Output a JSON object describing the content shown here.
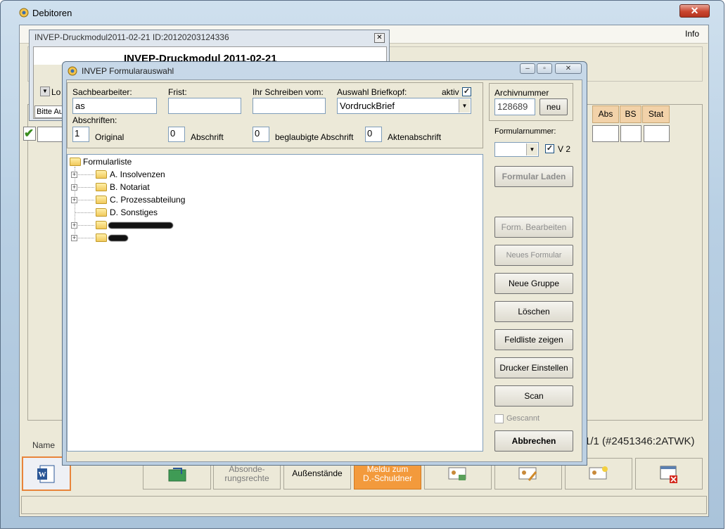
{
  "main_window": {
    "title": "Debitoren",
    "close_glyph": "✕",
    "menu": {
      "info": "Info"
    },
    "grid_headers": [
      "Abs",
      "BS",
      "Stat"
    ],
    "name_label": "Name",
    "record_info": "1/1 (#2451346:2ATWK)",
    "toolbar": {
      "absonderungsrechte": "Absonde-\nrungsrechte",
      "aussenstaende": "Außenstände",
      "meldung": "Meldu zum\nD.-Schuldner"
    }
  },
  "druck_window": {
    "title": "INVEP-Druckmodul2011-02-21 ID:20120203124336",
    "heading": "INVEP-Druckmodul 2011-02-21",
    "lo_label": "Lo",
    "bitte_label": "Bitte Au"
  },
  "dialog": {
    "title": "INVEP Formularauswahl",
    "labels": {
      "sachbearbeiter": "Sachbearbeiter:",
      "frist": "Frist:",
      "ihr_schreiben": "Ihr Schreiben vom:",
      "briefkopf": "Auswahl Briefkopf:",
      "aktiv": "aktiv",
      "abschriften": "Abschriften:",
      "original": "Original",
      "abschrift": "Abschrift",
      "beglaubigte": "beglaubigte Abschrift",
      "akten": "Aktenabschrift"
    },
    "values": {
      "sachbearbeiter": "as",
      "frist": "",
      "ihr_schreiben": "",
      "briefkopf": "VordruckBrief",
      "aktiv": true,
      "original_count": "1",
      "abschrift_count": "0",
      "beglaubigte_count": "0",
      "akten_count": "0"
    },
    "tree": {
      "root": "Formularliste",
      "items": [
        {
          "label": "A. Insolvenzen",
          "expandable": true
        },
        {
          "label": "B. Notariat",
          "expandable": true
        },
        {
          "label": "C. Prozessabteilung",
          "expandable": true
        },
        {
          "label": "D. Sonstiges",
          "expandable": false
        }
      ]
    },
    "archiv": {
      "label": "Archivnummer",
      "value": "128689",
      "neu_button": "neu"
    },
    "formularnummer": {
      "label": "Formularnummer:",
      "value": "",
      "v2_label": "V 2",
      "v2_checked": true
    },
    "buttons": {
      "laden": "Formular Laden",
      "bearbeiten": "Form. Bearbeiten",
      "neues": "Neues Formular",
      "gruppe": "Neue Gruppe",
      "loeschen": "Löschen",
      "feldliste": "Feldliste zeigen",
      "drucker": "Drucker Einstellen",
      "scan": "Scan",
      "abbrechen": "Abbrechen"
    },
    "gescannt": {
      "label": "Gescannt",
      "checked": false
    }
  },
  "colors": {
    "orange_accent": "#f39a3c",
    "grid_header": "#f2d2a9",
    "close_red": "#c9462f"
  }
}
